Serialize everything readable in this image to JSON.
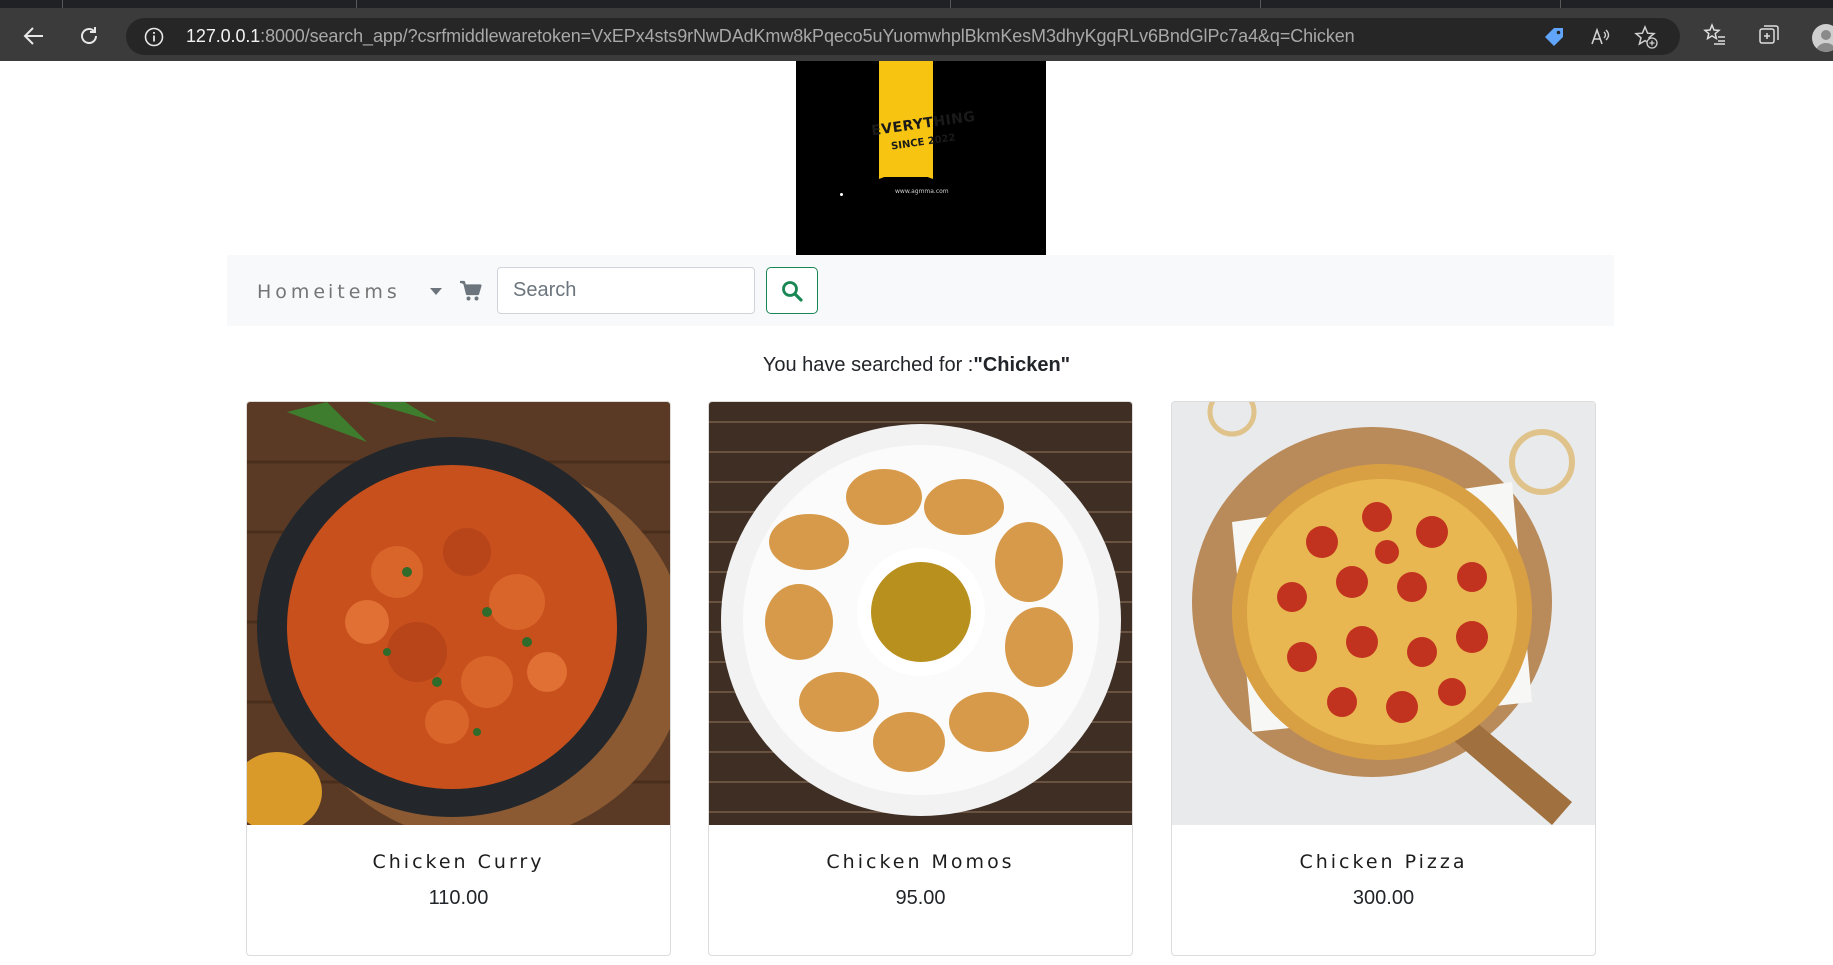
{
  "browser": {
    "url_host": "127.0.0.1",
    "url_rest": ":8000/search_app/?csrfmiddlewaretoken=VxEPx4sts9rNwDAdKmw8kPqeco5uYuomwhplBkmKesM3dhyKgqRLv6BndGlPc7a4&q=Chicken",
    "icons": [
      "back-icon",
      "reload-icon",
      "info-icon",
      "tag-icon",
      "read-aloud-icon",
      "add-favorite-icon",
      "favorites-icon",
      "collections-icon",
      "profile-avatar"
    ]
  },
  "logo": {
    "brand": "EVERYTHING",
    "since": "SINCE 2022",
    "site": "www.agmma.com",
    "colors": {
      "background": "#000000",
      "banner": "#f7c411"
    }
  },
  "nav": {
    "home": "Home",
    "items": "items",
    "search_placeholder": "Search",
    "search_value": "",
    "accent": "#198754"
  },
  "search": {
    "prefix": "You have searched for :",
    "query": "\"Chicken\""
  },
  "products": [
    {
      "name": "Chicken Curry",
      "price": "110.00"
    },
    {
      "name": "Chicken Momos",
      "price": "95.00"
    },
    {
      "name": "Chicken Pizza",
      "price": "300.00"
    }
  ]
}
